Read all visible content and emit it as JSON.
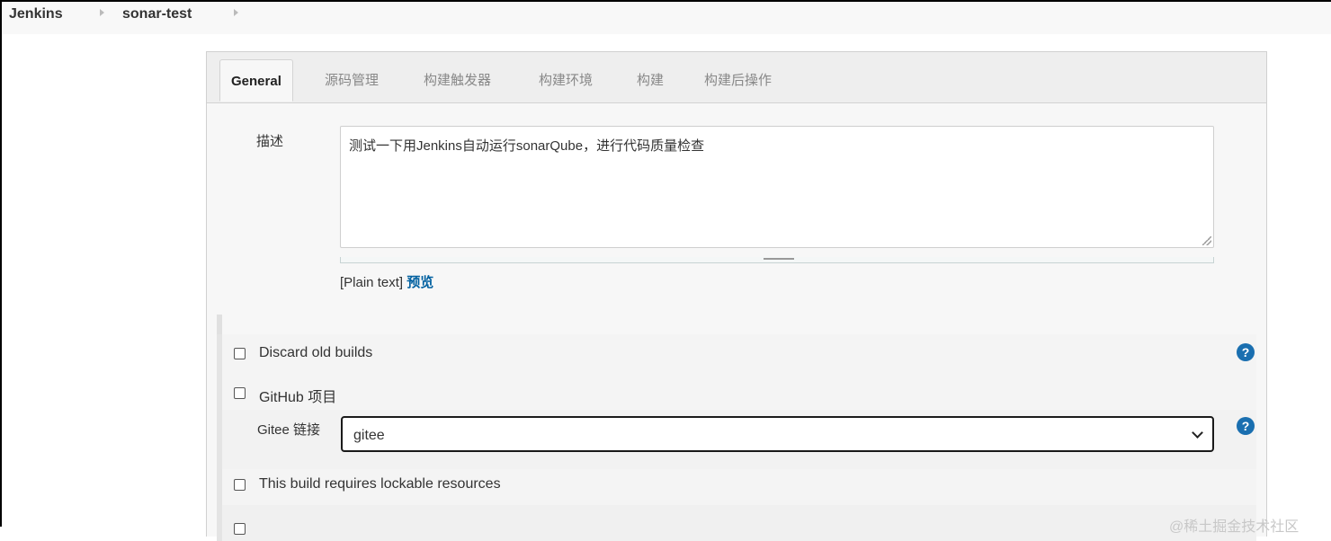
{
  "breadcrumb": {
    "items": [
      "Jenkins",
      "sonar-test"
    ]
  },
  "tabs": [
    {
      "label": "General",
      "active": true
    },
    {
      "label": "源码管理"
    },
    {
      "label": "构建触发器"
    },
    {
      "label": "构建环境"
    },
    {
      "label": "构建"
    },
    {
      "label": "构建后操作"
    }
  ],
  "general": {
    "description": {
      "label": "描述",
      "value": "测试一下用Jenkins自动运行sonarQube，进行代码质量检查",
      "format_text": "[Plain text]",
      "preview_label": "预览"
    },
    "options": [
      {
        "label": "Discard old builds",
        "checked": false,
        "has_help": true
      },
      {
        "label": "GitHub 项目",
        "checked": false,
        "has_help": false
      },
      {
        "label": "This build requires lockable resources",
        "checked": false,
        "has_help": false
      }
    ],
    "gitee": {
      "label": "Gitee 链接",
      "selected": "gitee"
    }
  },
  "icons": {
    "help": "?",
    "help_color": "#1a6fb0"
  },
  "watermark": "@稀土掘金技术社区"
}
